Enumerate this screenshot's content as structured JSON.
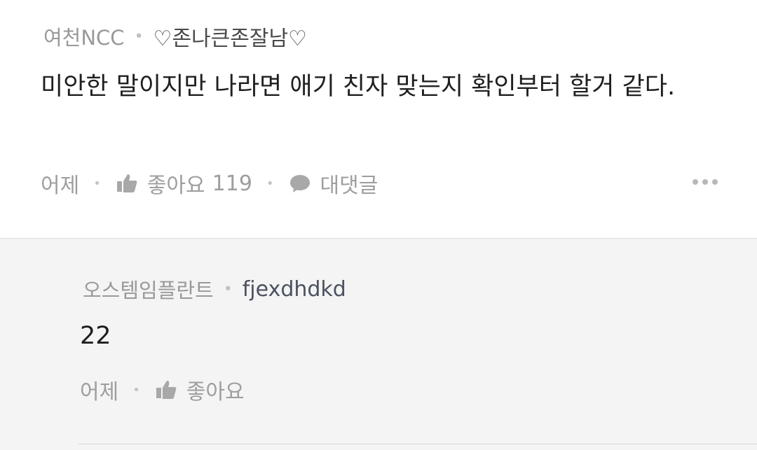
{
  "comment": {
    "community": "여천NCC",
    "nickname": "♡존나큰존잘남♡",
    "body": "미안한 말이지만 나라면 애기 친자 맞는지 확인부터 할거 같다.",
    "time": "어제",
    "like_label": "좋아요",
    "like_count": "119",
    "reply_label": "대댓글"
  },
  "reply": {
    "community": "오스템임플란트",
    "nickname": "fjexdhdkd",
    "body": "22",
    "time": "어제",
    "like_label": "좋아요"
  },
  "icons": {
    "like": "thumbs-up-icon",
    "reply": "speech-bubble-icon",
    "more": "more-dots-icon"
  },
  "colors": {
    "meta_gray": "#999999",
    "text_dark": "#1f1f1f",
    "reply_background": "#f4f4f4",
    "divider": "#dcdcdc"
  }
}
